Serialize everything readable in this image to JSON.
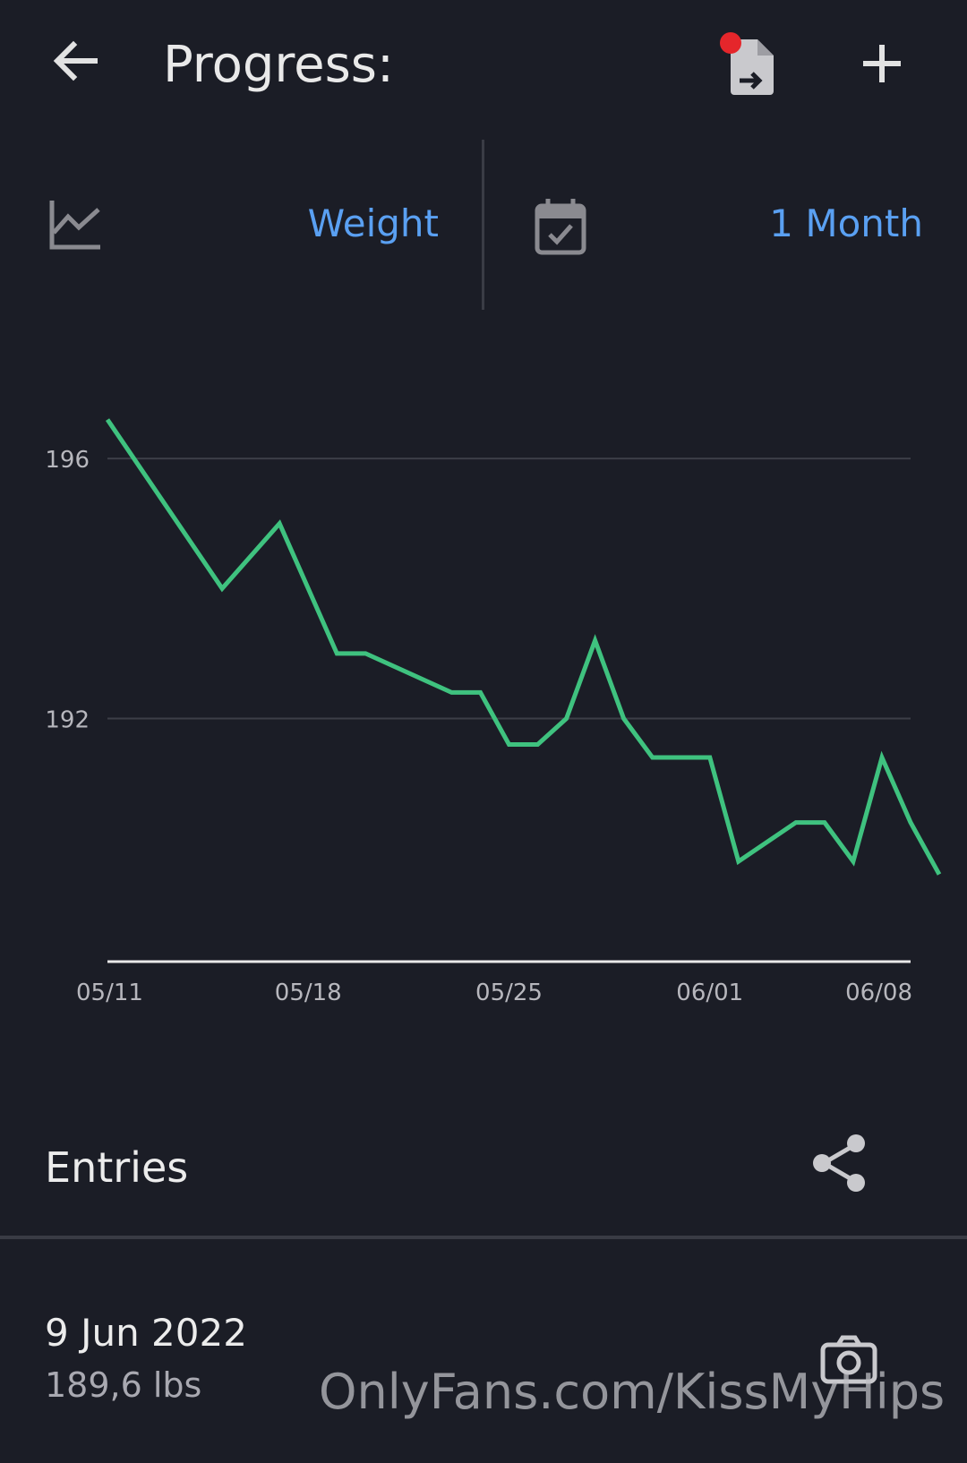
{
  "header": {
    "title": "Progress:",
    "back_icon": "arrow-left-icon",
    "export_icon": "file-export-icon",
    "add_icon": "plus-icon",
    "notification_dot_color": "#e5262b"
  },
  "filters": {
    "metric_icon": "line-chart-icon",
    "metric_label": "Weight",
    "period_icon": "calendar-check-icon",
    "period_label": "1 Month",
    "accent_color": "#5aa0f2"
  },
  "chart_data": {
    "type": "line",
    "x_tick_labels": [
      "05/11",
      "05/18",
      "05/25",
      "06/01",
      "06/08"
    ],
    "y_tick_labels": [
      "196",
      "192"
    ],
    "ylim": [
      188.3,
      197.6
    ],
    "grid": true,
    "series": [
      {
        "color": "#3fc27f",
        "points": [
          [
            "05/11",
            196.6
          ],
          [
            "05/15",
            194.0
          ],
          [
            "05/17",
            195.0
          ],
          [
            "05/19",
            193.0
          ],
          [
            "05/20",
            193.0
          ],
          [
            "05/23",
            192.4
          ],
          [
            "05/24",
            192.4
          ],
          [
            "05/25",
            191.6
          ],
          [
            "05/26",
            191.6
          ],
          [
            "05/27",
            192.0
          ],
          [
            "05/28",
            193.2
          ],
          [
            "05/29",
            192.0
          ],
          [
            "05/30",
            191.4
          ],
          [
            "06/01",
            191.4
          ],
          [
            "06/02",
            189.8
          ],
          [
            "06/04",
            190.4
          ],
          [
            "06/05",
            190.4
          ],
          [
            "06/06",
            189.8
          ],
          [
            "06/07",
            191.4
          ],
          [
            "06/08",
            190.4
          ],
          [
            "06/09",
            189.6
          ]
        ]
      }
    ]
  },
  "entries": {
    "title": "Entries",
    "share_icon": "share-icon",
    "items": [
      {
        "date": "9 Jun 2022",
        "value": "189,6 lbs",
        "icon": "camera-icon"
      }
    ]
  },
  "watermark": "OnlyFans.com/KissMyHips"
}
